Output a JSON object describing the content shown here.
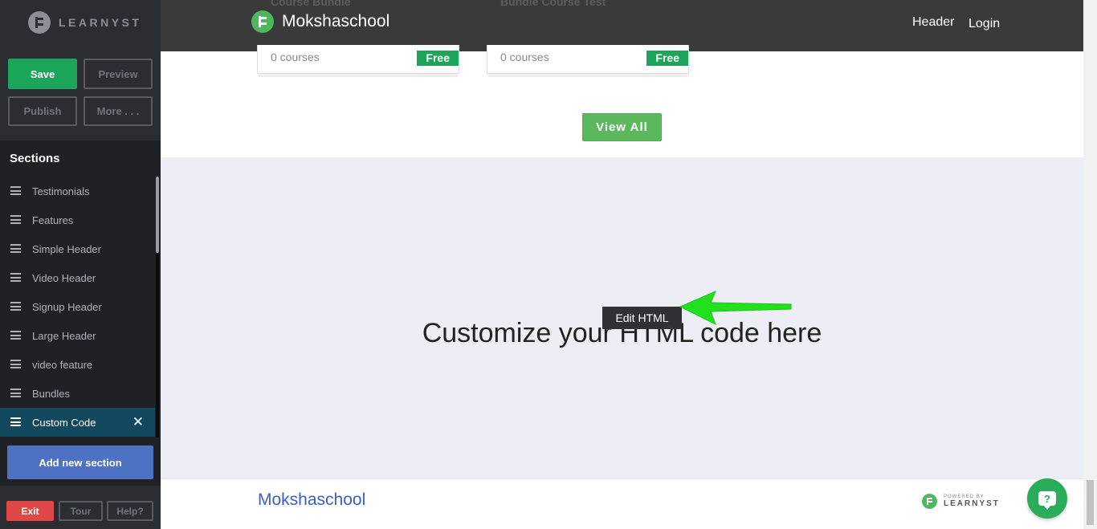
{
  "editor": {
    "brand": "LEARNYST",
    "toolbar": {
      "save": "Save",
      "preview": "Preview",
      "publish": "Publish",
      "more": "More . . ."
    },
    "sections_title": "Sections",
    "sections": [
      {
        "label": "Testimonials"
      },
      {
        "label": "Features"
      },
      {
        "label": "Simple Header"
      },
      {
        "label": "Video Header"
      },
      {
        "label": "Signup Header"
      },
      {
        "label": "Large Header"
      },
      {
        "label": "video feature"
      },
      {
        "label": "Bundles"
      },
      {
        "label": "Custom Code",
        "active": true
      }
    ],
    "close_symbol": "✕",
    "add_section": "Add new section",
    "bottom": {
      "exit": "Exit",
      "tour": "Tour",
      "help": "Help?"
    }
  },
  "site": {
    "name": "Mokshaschool",
    "nav": {
      "header": "Header",
      "login": "Login"
    },
    "cards": [
      {
        "title": "Course Bundle",
        "count": "0 courses",
        "badge": "Free"
      },
      {
        "title": "Bundle Course Test",
        "count": "0 courses",
        "badge": "Free"
      }
    ],
    "view_all": "View All",
    "custom_heading": "Customize your HTML code here",
    "edit_tooltip": "Edit HTML",
    "footer": {
      "name": "Mokshaschool",
      "powered_by": "POWERED BY",
      "powered_brand": "LEARNYST"
    },
    "help_glyph": "?"
  },
  "colors": {
    "save_green": "#1aa55a",
    "active_section": "#13485e",
    "add_blue": "#4d72c4",
    "exit_red": "#e04848",
    "arrow_green": "#22e01b",
    "footer_link": "#3a5fc4"
  }
}
